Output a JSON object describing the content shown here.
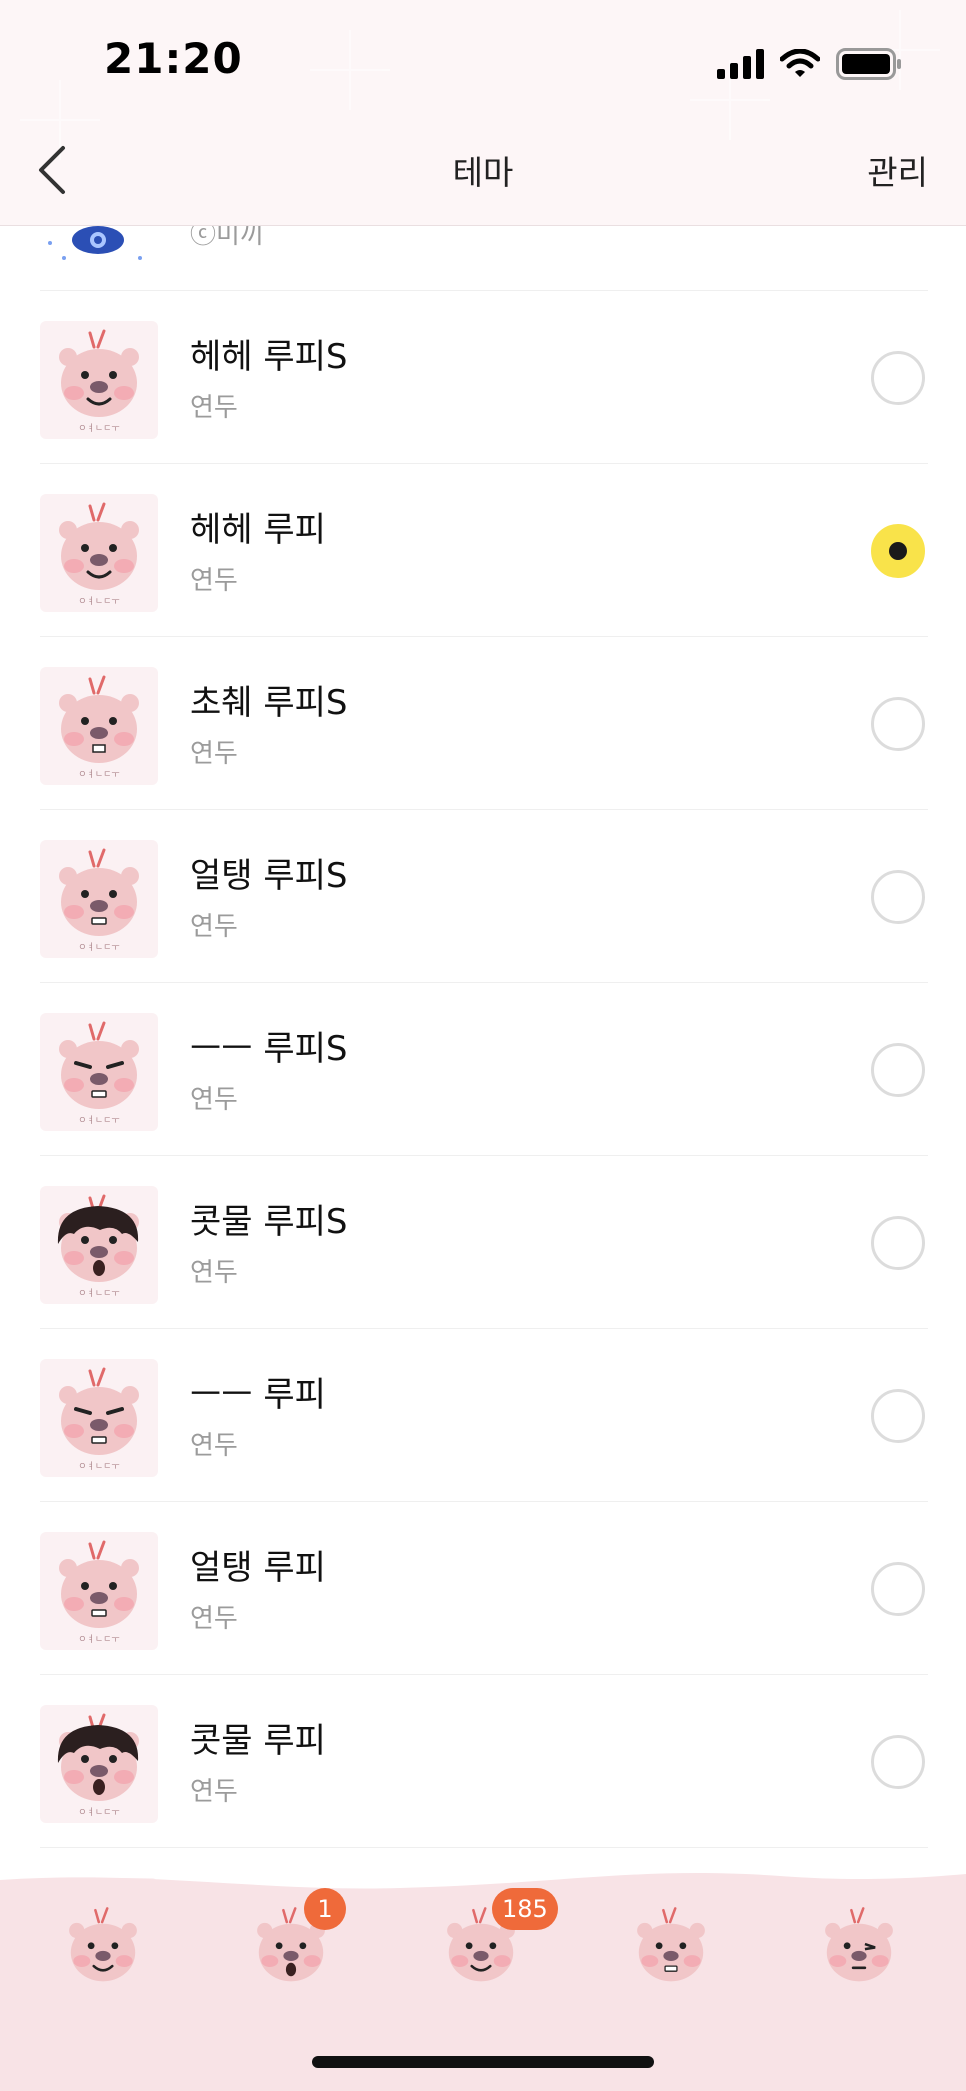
{
  "status_bar": {
    "time": "21:20"
  },
  "nav": {
    "title": "테마",
    "manage_label": "관리"
  },
  "partial_item": {
    "subtitle": "ⓒ미끼"
  },
  "items": [
    {
      "title": "헤헤 루피S",
      "subtitle": "연두",
      "selected": false,
      "face": "smile"
    },
    {
      "title": "헤헤 루피",
      "subtitle": "연두",
      "selected": true,
      "face": "smile"
    },
    {
      "title": "초췌 루피S",
      "subtitle": "연두",
      "selected": false,
      "face": "tired"
    },
    {
      "title": "얼탱 루피S",
      "subtitle": "연두",
      "selected": false,
      "face": "blank"
    },
    {
      "title": "ㅡㅡ 루피S",
      "subtitle": "연두",
      "selected": false,
      "face": "annoyed"
    },
    {
      "title": "콧물 루피S",
      "subtitle": "연두",
      "selected": false,
      "face": "hair"
    },
    {
      "title": "ㅡㅡ 루피",
      "subtitle": "연두",
      "selected": false,
      "face": "annoyed"
    },
    {
      "title": "얼탱 루피",
      "subtitle": "연두",
      "selected": false,
      "face": "blank"
    },
    {
      "title": "콧물 루피",
      "subtitle": "연두",
      "selected": false,
      "face": "hair"
    }
  ],
  "tabs": [
    {
      "name": "friends",
      "badge": ""
    },
    {
      "name": "chats",
      "badge": "1"
    },
    {
      "name": "openchat",
      "badge": "185"
    },
    {
      "name": "shopping",
      "badge": ""
    },
    {
      "name": "more",
      "badge": ""
    }
  ],
  "colors": {
    "header_bg": "#fdf6f7",
    "radio_selected": "#f9e34a",
    "badge": "#ef6a3a",
    "tabbar_bg": "#f8e3e6"
  }
}
